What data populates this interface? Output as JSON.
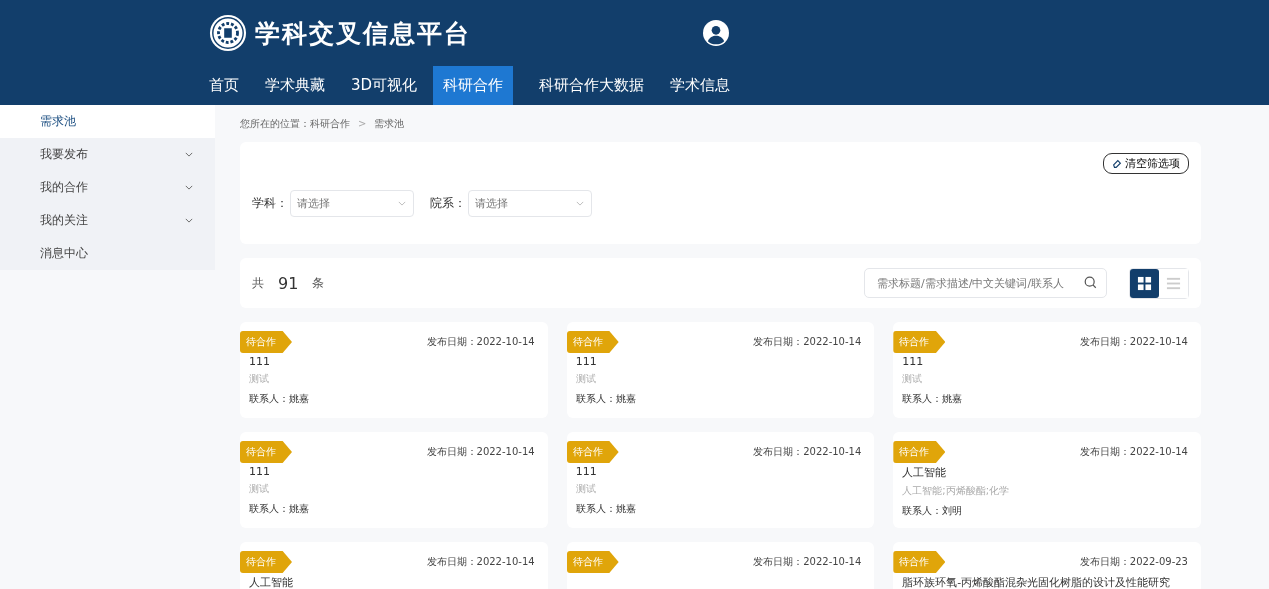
{
  "header": {
    "site_title": "学科交叉信息平台"
  },
  "nav": [
    {
      "label": "首页",
      "selected": false
    },
    {
      "label": "学术典藏",
      "selected": false
    },
    {
      "label": "3D可视化",
      "selected": false
    },
    {
      "label": "科研合作",
      "selected": true
    },
    {
      "label": "科研合作大数据",
      "selected": false
    },
    {
      "label": "学术信息",
      "selected": false
    }
  ],
  "sidebar": {
    "items": [
      {
        "label": "需求池",
        "selected": true,
        "expandable": false
      },
      {
        "label": "我要发布",
        "selected": false,
        "expandable": true
      },
      {
        "label": "我的合作",
        "selected": false,
        "expandable": true
      },
      {
        "label": "我的关注",
        "selected": false,
        "expandable": true
      },
      {
        "label": "消息中心",
        "selected": false,
        "expandable": false
      }
    ]
  },
  "breadcrumb": [
    "您所在的位置：科研合作",
    ">",
    "需求池"
  ],
  "filters": {
    "clear_button": "清空筛选项",
    "fields": [
      {
        "label": "学科：",
        "placeholder": "请选择"
      },
      {
        "label": "院系：",
        "placeholder": "请选择"
      }
    ]
  },
  "summary": {
    "prefix": "共",
    "count": "91",
    "suffix": "条",
    "search_placeholder": "需求标题/需求描述/中文关键词/联系人",
    "views": [
      {
        "kind": "grid",
        "selected": true
      },
      {
        "kind": "list",
        "selected": false
      }
    ]
  },
  "cards": [
    {
      "status": "待合作",
      "date": "发布日期：2022-10-14",
      "title": "111",
      "description": "测试",
      "contact": "联系人：姚嘉"
    },
    {
      "status": "待合作",
      "date": "发布日期：2022-10-14",
      "title": "111",
      "description": "测试",
      "contact": "联系人：姚嘉"
    },
    {
      "status": "待合作",
      "date": "发布日期：2022-10-14",
      "title": "111",
      "description": "测试",
      "contact": "联系人：姚嘉"
    },
    {
      "status": "待合作",
      "date": "发布日期：2022-10-14",
      "title": "111",
      "description": "测试",
      "contact": "联系人：姚嘉"
    },
    {
      "status": "待合作",
      "date": "发布日期：2022-10-14",
      "title": "111",
      "description": "测试",
      "contact": "联系人：姚嘉"
    },
    {
      "status": "待合作",
      "date": "发布日期：2022-10-14",
      "title": "人工智能",
      "description": "人工智能;丙烯酸酯;化学",
      "contact": "联系人：刘明"
    },
    {
      "status": "待合作",
      "date": "发布日期：2022-10-14",
      "title": "人工智能"
    },
    {
      "status": "待合作",
      "date": "发布日期：2022-10-14"
    },
    {
      "status": "待合作",
      "date": "发布日期：2022-09-23",
      "title": "脂环族环氧-丙烯酸酯混杂光固化树脂的设计及性能研究"
    }
  ]
}
